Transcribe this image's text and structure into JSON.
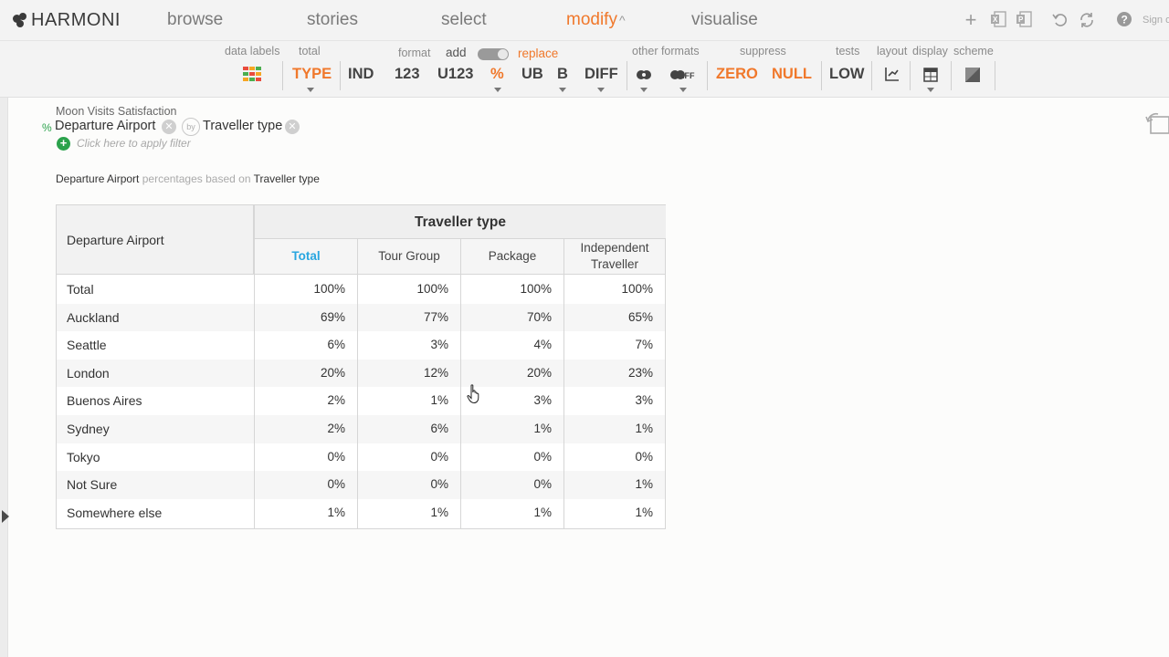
{
  "app": {
    "logo_text": "HARMONI"
  },
  "nav": {
    "items": [
      {
        "label": "browse"
      },
      {
        "label": "stories"
      },
      {
        "label": "select"
      },
      {
        "label": "modify"
      },
      {
        "label": "visualise"
      }
    ],
    "caret": "^",
    "sign_in": "Sign o"
  },
  "toolbar": {
    "labels": {
      "data_labels": "data labels",
      "total": "total",
      "format": "format",
      "add": "add",
      "replace": "replace",
      "other_formats": "other formats",
      "suppress": "suppress",
      "tests": "tests",
      "layout": "layout",
      "display": "display",
      "scheme": "scheme"
    },
    "buttons": {
      "type": "TYPE",
      "ind": "IND",
      "n123": "123",
      "u123": "U123",
      "pct": "%",
      "ub": "UB",
      "b": "B",
      "diff": "DIFF",
      "zero": "ZERO",
      "null": "NULL",
      "low": "LOW"
    },
    "accent": "#f0782b"
  },
  "report": {
    "title": "Moon Visits Satisfaction",
    "pct_symbol": "%",
    "row_var": "Departure Airport",
    "by": "by",
    "col_var": "Traveller type",
    "filter_placeholder": "Click here to apply filter",
    "desc_var": "Departure Airport",
    "desc_mid": "percentages based on",
    "desc_base": "Traveller type"
  },
  "table": {
    "corner_label": "Departure Airport",
    "group_header": "Traveller type",
    "columns": [
      "Total",
      "Tour Group",
      "Package",
      "Independent Traveller"
    ],
    "rows": [
      {
        "label": "Total",
        "values": [
          "100%",
          "100%",
          "100%",
          "100%"
        ]
      },
      {
        "label": "Auckland",
        "values": [
          "69%",
          "77%",
          "70%",
          "65%"
        ]
      },
      {
        "label": "Seattle",
        "values": [
          "6%",
          "3%",
          "4%",
          "7%"
        ]
      },
      {
        "label": "London",
        "values": [
          "20%",
          "12%",
          "20%",
          "23%"
        ]
      },
      {
        "label": "Buenos Aires",
        "values": [
          "2%",
          "1%",
          "3%",
          "3%"
        ]
      },
      {
        "label": "Sydney",
        "values": [
          "2%",
          "6%",
          "1%",
          "1%"
        ]
      },
      {
        "label": "Tokyo",
        "values": [
          "0%",
          "0%",
          "0%",
          "0%"
        ]
      },
      {
        "label": "Not Sure",
        "values": [
          "0%",
          "0%",
          "0%",
          "1%"
        ]
      },
      {
        "label": "Somewhere else",
        "values": [
          "1%",
          "1%",
          "1%",
          "1%"
        ]
      }
    ],
    "total_color": "#29a6e0"
  }
}
